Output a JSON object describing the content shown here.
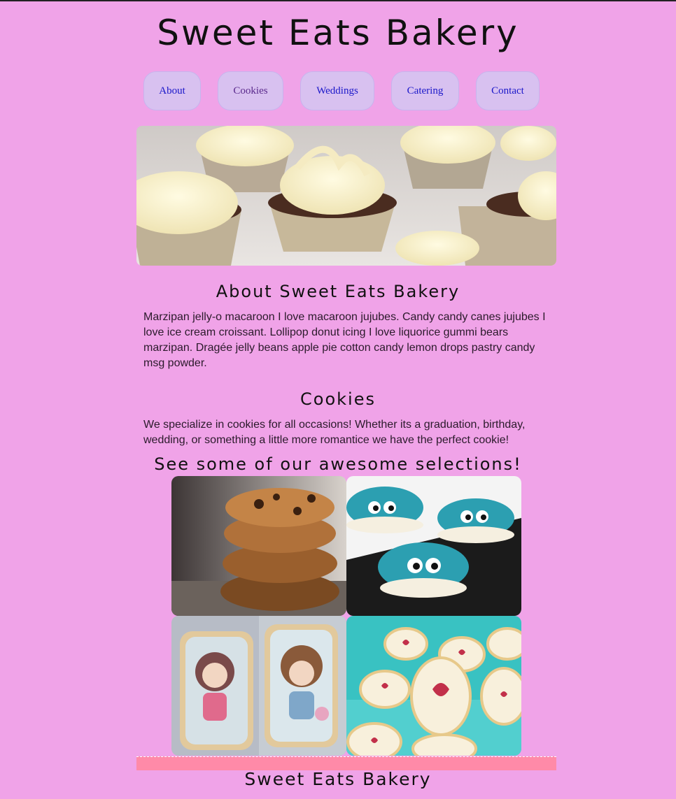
{
  "header": {
    "title": "Sweet Eats Bakery"
  },
  "nav": {
    "items": [
      {
        "label": "About"
      },
      {
        "label": "Cookies"
      },
      {
        "label": "Weddings"
      },
      {
        "label": "Catering"
      },
      {
        "label": "Contact"
      }
    ]
  },
  "about": {
    "heading": "About Sweet Eats Bakery",
    "body": "Marzipan jelly-o macaroon I love macaroon jujubes. Candy candy canes jujubes I love ice cream croissant. Lollipop donut icing I love liquorice gummi bears marzipan. Dragée jelly beans apple pie cotton candy lemon drops pastry candy msg powder."
  },
  "cookies": {
    "heading": "Cookies",
    "body": "We specialize in cookies for all occasions! Whether its a graduation, birthday, wedding, or something a little more romantice we have the perfect cookie!",
    "gallery_heading": "See some of our awesome selections!"
  },
  "footer": {
    "title": "Sweet Eats Bakery"
  },
  "colors": {
    "background": "#f0a3e8",
    "nav_button": "#d8c1f0",
    "link": "#1a17c9",
    "footer_bar": "#ff8aa8"
  }
}
